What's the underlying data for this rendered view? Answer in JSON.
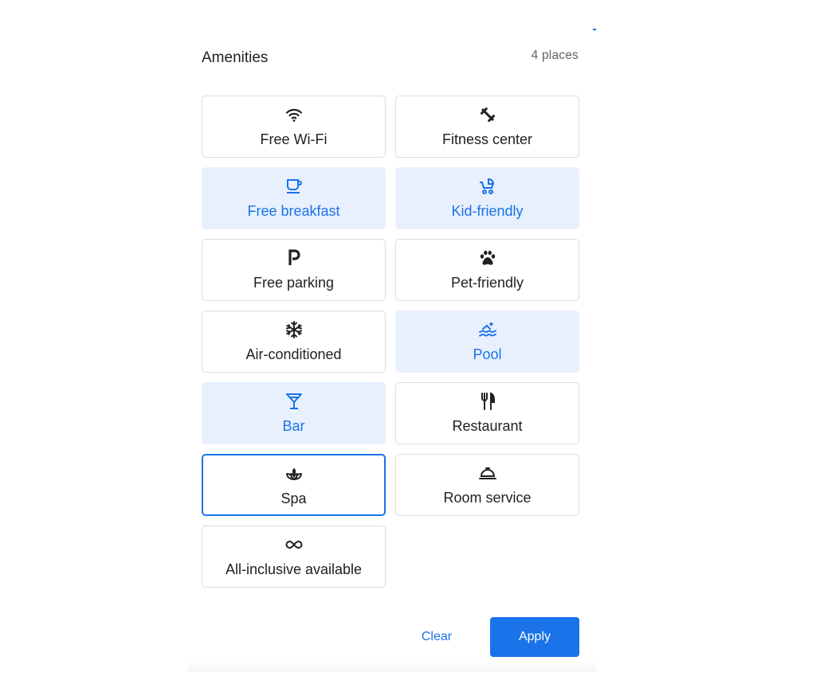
{
  "header": {
    "title": "Amenities",
    "count": "4 places"
  },
  "amenities": [
    {
      "label": "Free Wi-Fi",
      "icon": "wifi-icon",
      "state": "default"
    },
    {
      "label": "Fitness center",
      "icon": "fitness-icon",
      "state": "default"
    },
    {
      "label": "Free breakfast",
      "icon": "coffee-cup-icon",
      "state": "selected"
    },
    {
      "label": "Kid-friendly",
      "icon": "stroller-icon",
      "state": "selected"
    },
    {
      "label": "Free parking",
      "icon": "parking-icon",
      "state": "default"
    },
    {
      "label": "Pet-friendly",
      "icon": "paw-icon",
      "state": "default"
    },
    {
      "label": "Air-conditioned",
      "icon": "snowflake-icon",
      "state": "default"
    },
    {
      "label": "Pool",
      "icon": "pool-icon",
      "state": "selected"
    },
    {
      "label": "Bar",
      "icon": "cocktail-icon",
      "state": "selected"
    },
    {
      "label": "Restaurant",
      "icon": "fork-knife-icon",
      "state": "default"
    },
    {
      "label": "Spa",
      "icon": "spa-icon",
      "state": "focused"
    },
    {
      "label": "Room service",
      "icon": "room-service-icon",
      "state": "default"
    },
    {
      "label": "All-inclusive available",
      "icon": "infinity-icon",
      "state": "default"
    }
  ],
  "footer": {
    "clear_label": "Clear",
    "apply_label": "Apply"
  },
  "colors": {
    "accent": "#1a73e8",
    "selected_bg": "#e8f0fe",
    "text": "#202124",
    "border": "#dadce0"
  }
}
